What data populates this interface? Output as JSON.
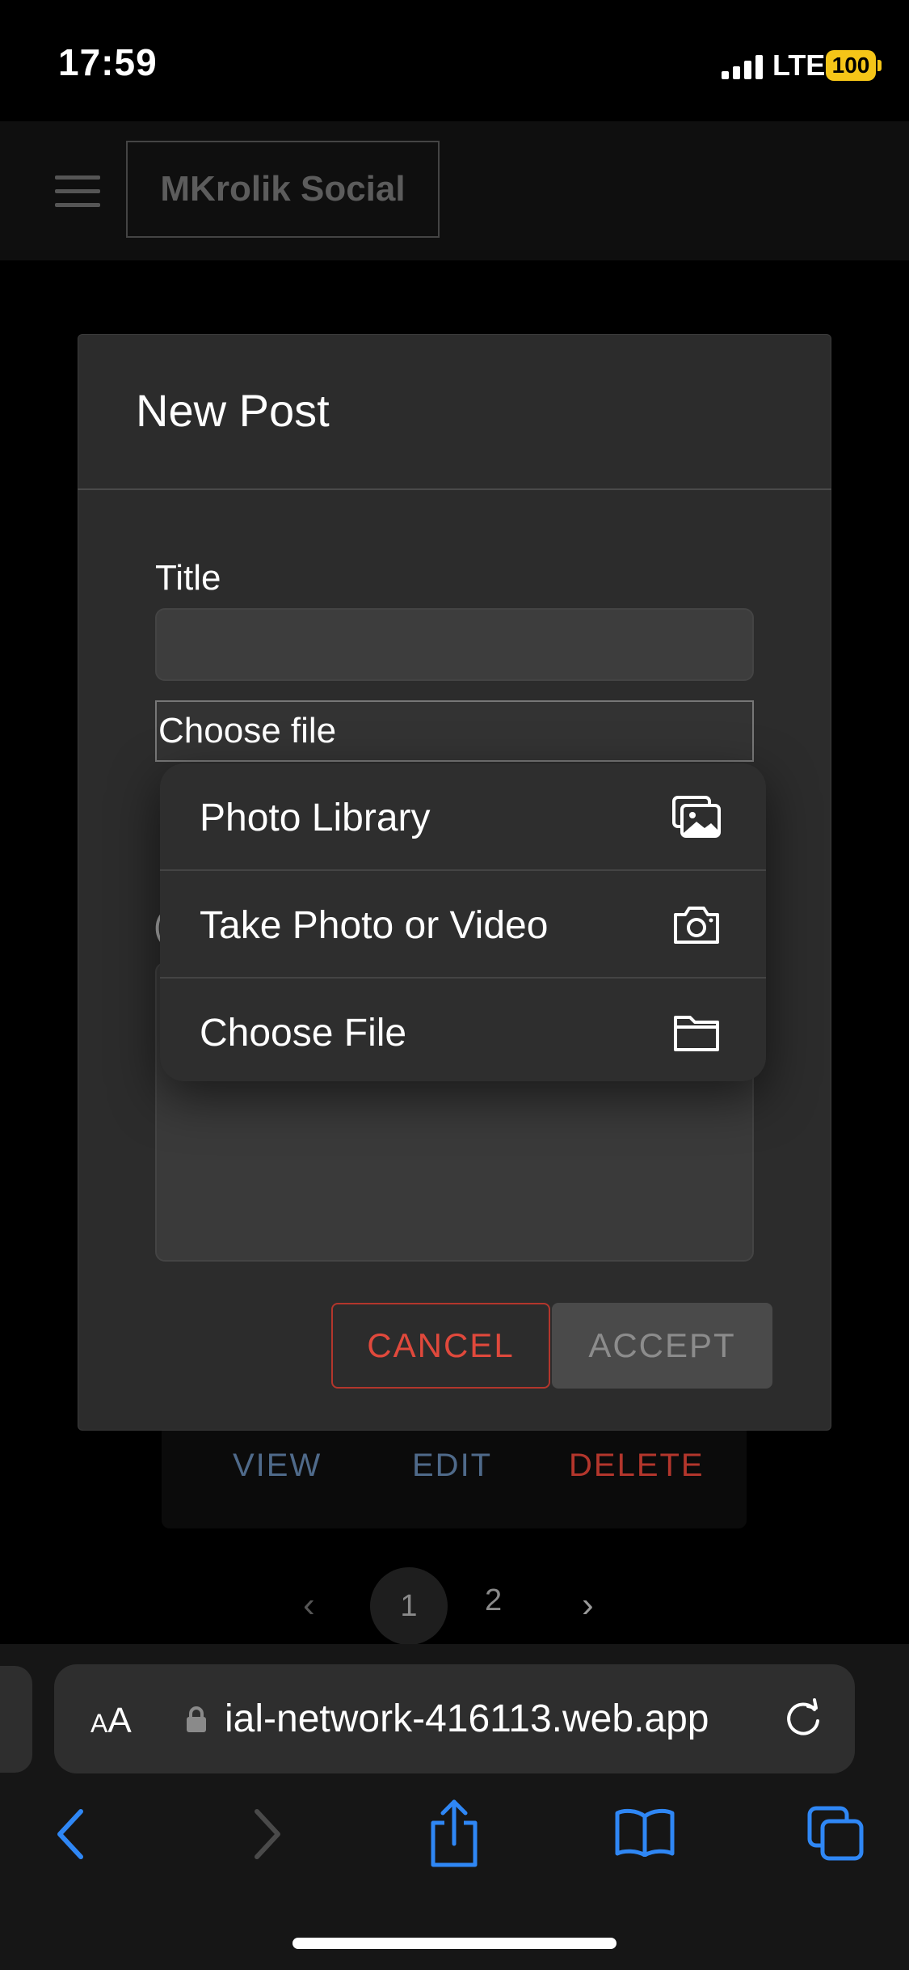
{
  "status_bar": {
    "time": "17:59",
    "network": "LTE",
    "battery": "100"
  },
  "header": {
    "brand": "MKrolik Social",
    "menu_icon": "hamburger-icon"
  },
  "modal": {
    "title": "New Post",
    "title_label": "Title",
    "title_value": "",
    "file_button_label": "Choose file",
    "cancel_label": "CANCEL",
    "accept_label": "ACCEPT"
  },
  "file_picker": {
    "items": [
      {
        "label": "Photo Library",
        "icon": "photo-library-icon"
      },
      {
        "label": "Take Photo or Video",
        "icon": "camera-icon"
      },
      {
        "label": "Choose File",
        "icon": "folder-icon"
      }
    ]
  },
  "background": {
    "card_actions": [
      "VIEW",
      "EDIT",
      "DELETE"
    ],
    "pages": [
      "1",
      "2"
    ],
    "current_page": "1"
  },
  "browser": {
    "text_size_label": "AA",
    "url": "ial-network-416113.web.app",
    "toolbar_icons": [
      "back-icon",
      "forward-icon",
      "share-icon",
      "bookmarks-icon",
      "tabs-icon"
    ]
  },
  "colors": {
    "cancel": "#e0493c",
    "delete": "#b3362c",
    "link": "#4f6a8a",
    "safari_blue": "#2f87f5",
    "battery": "#f5c518"
  }
}
